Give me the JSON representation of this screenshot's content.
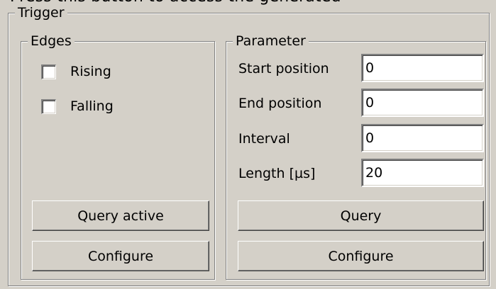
{
  "top_text": "Press this button to access the generated",
  "trigger": {
    "title": "Trigger",
    "edges": {
      "title": "Edges",
      "rising_label": "Rising",
      "falling_label": "Falling",
      "rising_checked": false,
      "falling_checked": false,
      "query_active_label": "Query active",
      "configure_label": "Configure"
    },
    "parameter": {
      "title": "Parameter",
      "start_position_label": "Start position",
      "start_position_value": "0",
      "end_position_label": "End position",
      "end_position_value": "0",
      "interval_label": "Interval",
      "interval_value": "0",
      "length_label": "Length [µs]",
      "length_value": "20",
      "query_label": "Query",
      "configure_label": "Configure"
    }
  }
}
